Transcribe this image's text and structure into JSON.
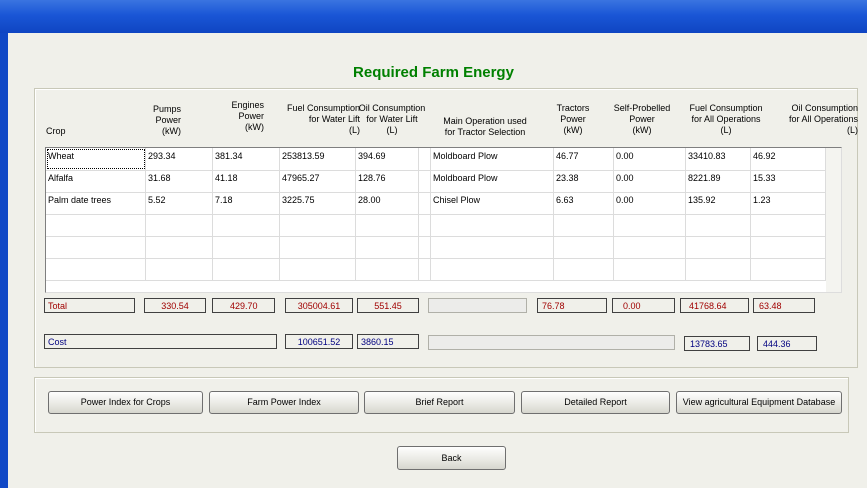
{
  "form": {
    "title": "Required Farm Energy"
  },
  "table": {
    "headers": {
      "crop": "Crop",
      "pumps": [
        "Pumps",
        "Power",
        "(kW)"
      ],
      "engines": [
        "Engines",
        "Power",
        "(kW)"
      ],
      "fuel_water": [
        "Fuel Consumption",
        "for Water Lift",
        "(L)"
      ],
      "oil_water": [
        "Oil Consumption",
        "for Water Lift",
        "(L)"
      ],
      "operation": [
        "Main Operation used",
        "for Tractor Selection"
      ],
      "tractors": [
        "Tractors",
        "Power",
        "(kW)"
      ],
      "self": [
        "Self-Probelled",
        "Power",
        "(kW)"
      ],
      "fuel_all": [
        "Fuel Consumption",
        "for All Operations",
        "(L)"
      ],
      "oil_all": [
        "Oil Consumption",
        "for All Operations",
        "(L)"
      ]
    },
    "rows": [
      {
        "crop": "Wheat",
        "pumps": "293.34",
        "engines": "381.34",
        "fuel_water": "253813.59",
        "oil_water": "394.69",
        "operation": "Moldboard Plow",
        "tractors": "46.77",
        "self": "0.00",
        "fuel_all": "33410.83",
        "oil_all": "46.92"
      },
      {
        "crop": "Alfalfa",
        "pumps": "31.68",
        "engines": "41.18",
        "fuel_water": "47965.27",
        "oil_water": "128.76",
        "operation": "Moldboard Plow",
        "tractors": "23.38",
        "self": "0.00",
        "fuel_all": "8221.89",
        "oil_all": "15.33"
      },
      {
        "crop": "Palm date trees",
        "pumps": "5.52",
        "engines": "7.18",
        "fuel_water": "3225.75",
        "oil_water": "28.00",
        "operation": "Chisel Plow",
        "tractors": "6.63",
        "self": "0.00",
        "fuel_all": "135.92",
        "oil_all": "1.23"
      },
      {
        "crop": "",
        "pumps": "",
        "engines": "",
        "fuel_water": "",
        "oil_water": "",
        "operation": "",
        "tractors": "",
        "self": "",
        "fuel_all": "",
        "oil_all": ""
      },
      {
        "crop": "",
        "pumps": "",
        "engines": "",
        "fuel_water": "",
        "oil_water": "",
        "operation": "",
        "tractors": "",
        "self": "",
        "fuel_all": "",
        "oil_all": ""
      },
      {
        "crop": "",
        "pumps": "",
        "engines": "",
        "fuel_water": "",
        "oil_water": "",
        "operation": "",
        "tractors": "",
        "self": "",
        "fuel_all": "",
        "oil_all": ""
      }
    ]
  },
  "total": {
    "label": "Total",
    "pumps": "330.54",
    "engines": "429.70",
    "fuel_water": "305004.61",
    "oil_water": "551.45",
    "operation": "",
    "tractors": "76.78",
    "self": "0.00",
    "fuel_all": "41768.64",
    "oil_all": "63.48"
  },
  "cost": {
    "label": "Cost",
    "fuel_water": "100651.52",
    "oil_water": "3860.15",
    "operation": "",
    "fuel_all": "13783.65",
    "oil_all": "444.36"
  },
  "buttons": {
    "power_index_crops": "Power Index for Crops",
    "farm_power_index": "Farm Power Index",
    "brief_report": "Brief Report",
    "detailed_report": "Detailed Report",
    "view_database": "View agricultural Equipment Database",
    "back": "Back"
  },
  "colors": {
    "title": "#008000",
    "total_text": "#a00000",
    "cost_text": "#000080",
    "titlebar": "#1a56d6"
  }
}
